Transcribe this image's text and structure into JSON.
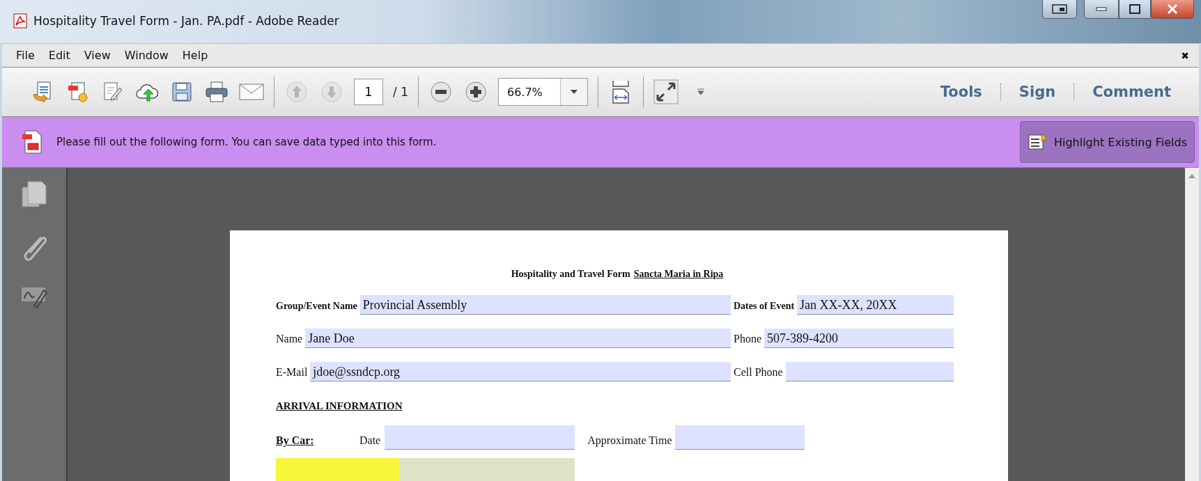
{
  "window": {
    "title": "Hospitality  Travel Form - Jan. PA.pdf - Adobe Reader"
  },
  "menu": {
    "items": [
      "File",
      "Edit",
      "View",
      "Window",
      "Help"
    ],
    "close_glyph": "✖"
  },
  "toolbar": {
    "nav_buttons": [
      {
        "disabled": true
      },
      {
        "disabled": true
      }
    ],
    "page": "1",
    "page_total": "/ 1",
    "zoom": "66.7%",
    "panes": [
      "Tools",
      "Sign",
      "Comment"
    ]
  },
  "notice": {
    "message": "Please fill out the following form. You can save data typed into this form.",
    "button": "Highlight Existing Fields"
  },
  "form": {
    "title": "Hospitality and Travel Form",
    "place": "Sancta Maria in Ripa",
    "rows": [
      {
        "kind": "pair",
        "fields": [
          {
            "label": "Group/Event Name",
            "bold": true,
            "value": "Provincial Assembly"
          },
          {
            "label": "Dates of Event",
            "bold": true,
            "value": "Jan XX-XX, 20XX"
          }
        ]
      },
      {
        "kind": "pair",
        "fields": [
          {
            "label": "Name",
            "bold": false,
            "value": "Jane Doe"
          },
          {
            "label": "Phone",
            "bold": false,
            "value": "507-389-4200"
          }
        ]
      },
      {
        "kind": "pair",
        "fields": [
          {
            "label": "E-Mail",
            "bold": false,
            "value": "jdoe@ssndcp.org"
          },
          {
            "label": "Cell Phone",
            "bold": false
          }
        ]
      },
      {
        "kind": "heading",
        "text": "ARRIVAL INFORMATION"
      },
      {
        "kind": "travel",
        "mode": "By Car:",
        "fields": [
          {
            "label": "Date"
          },
          {
            "label": "Approximate Time"
          }
        ]
      },
      {
        "kind": "partial",
        "focused": true
      }
    ]
  }
}
